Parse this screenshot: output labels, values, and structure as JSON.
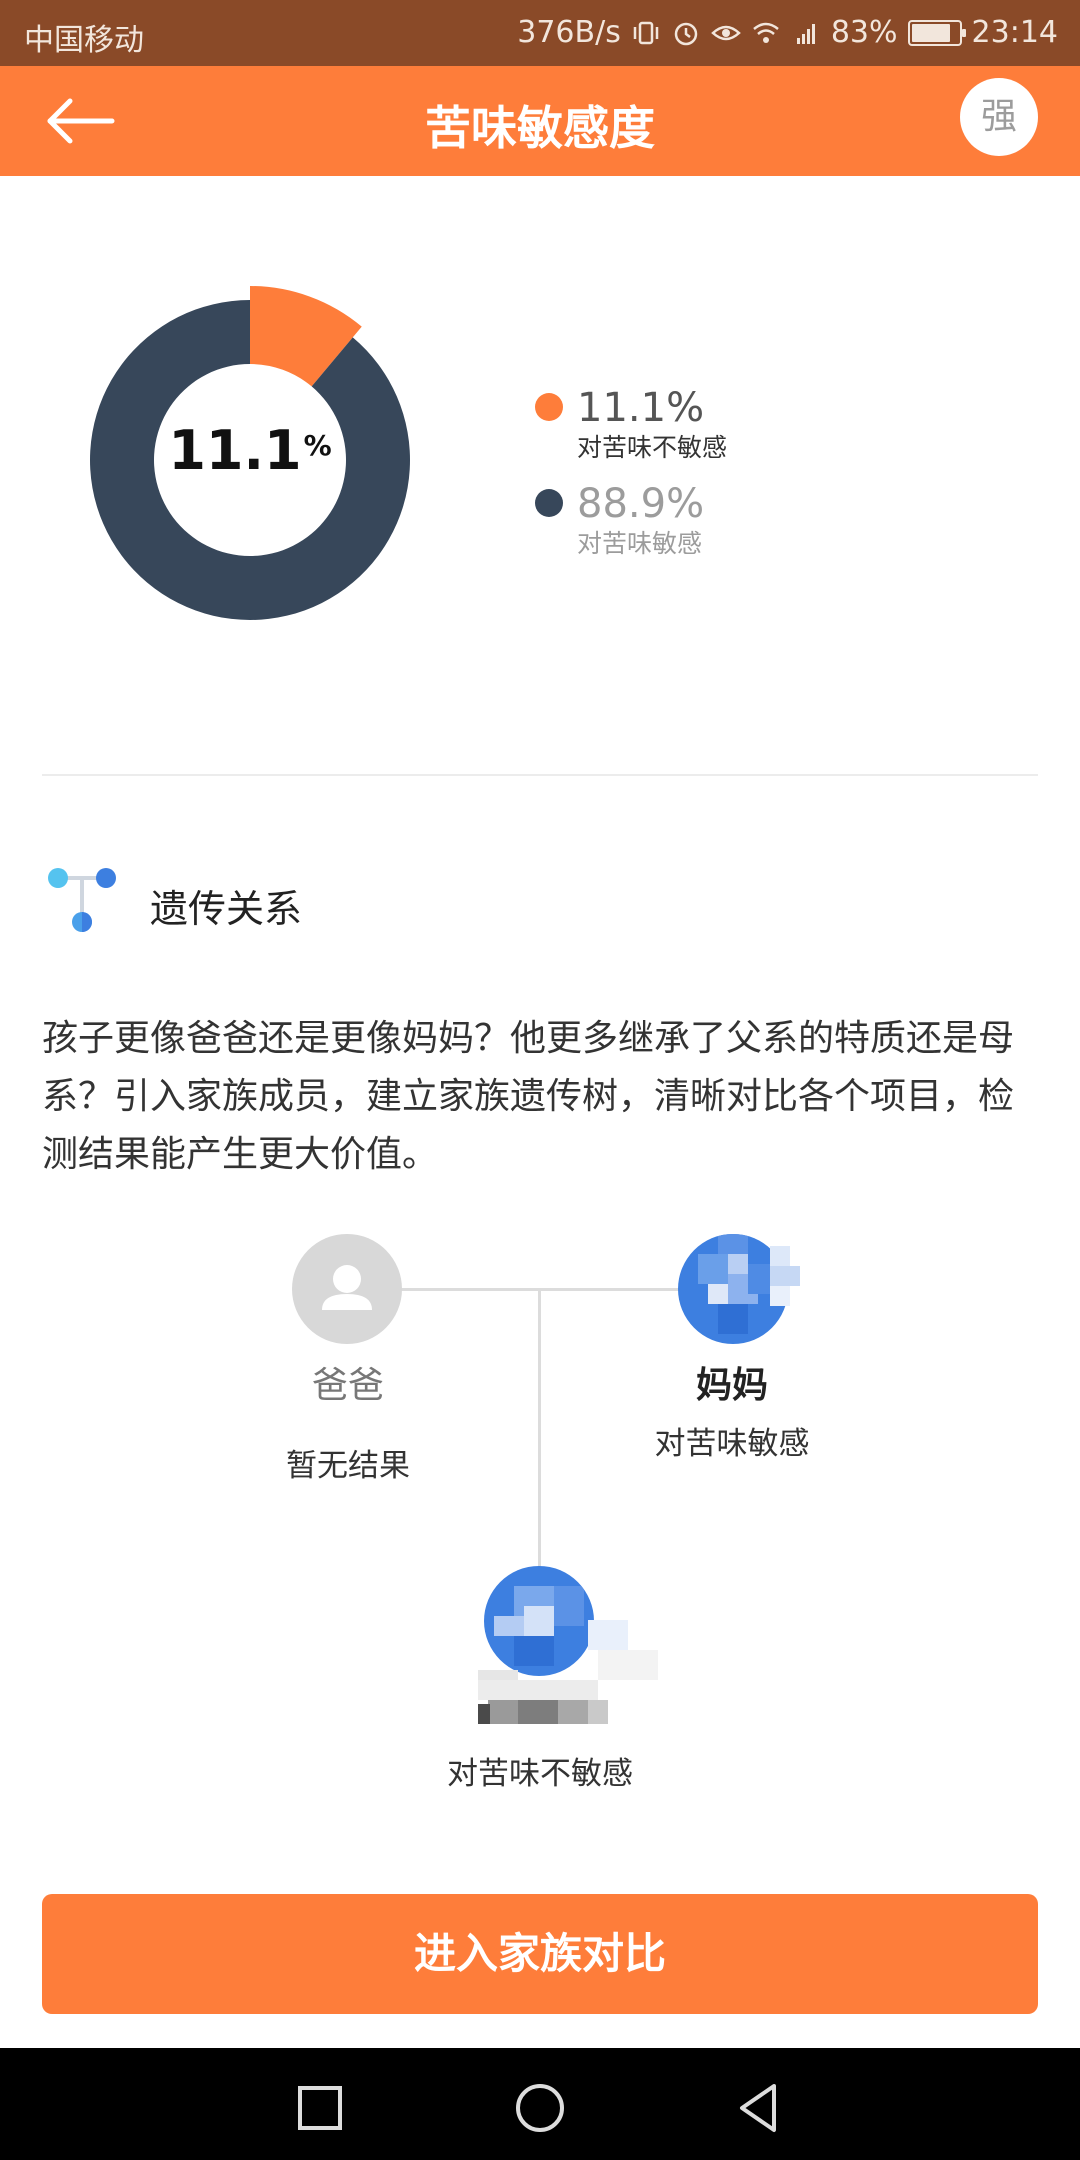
{
  "status_bar": {
    "carrier": "中国移动",
    "speed": "376B/s",
    "battery": "83%",
    "battery_level": 0.83,
    "time": "23:14",
    "icons": [
      "vibrate-icon",
      "alarm-icon",
      "eye-icon",
      "wifi-icon",
      "4g-signal-icon",
      "battery-icon"
    ]
  },
  "header": {
    "title": "苦味敏感度",
    "avatar_char": "强"
  },
  "chart_data": {
    "type": "pie",
    "center_value": "11.1",
    "center_unit": "%",
    "series": [
      {
        "name": "对苦味不敏感",
        "label": "11.1%",
        "value": 11.1,
        "color": "#fe7d3a",
        "highlight": true
      },
      {
        "name": "对苦味敏感",
        "label": "88.9%",
        "value": 88.9,
        "color": "#37475a",
        "highlight": false
      }
    ]
  },
  "genetics": {
    "title": "遗传关系",
    "description": "孩子更像爸爸还是更像妈妈？他更多继承了父系的特质还是母系？引入家族成员，建立家族遗传树，清晰对比各个项目，检测结果能产生更大价值。",
    "father": {
      "name": "爸爸",
      "result": "暂无结果"
    },
    "mother": {
      "name": "妈妈",
      "result": "对苦味敏感"
    },
    "child": {
      "result": "对苦味不敏感"
    }
  },
  "cta_label": "进入家族对比",
  "colors": {
    "accent": "#fe7d3a",
    "dark": "#37475a",
    "status_bar": "#8a4a28"
  }
}
